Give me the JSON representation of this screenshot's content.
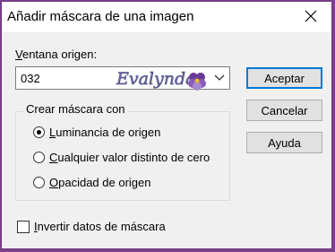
{
  "window": {
    "title": "Añadir máscara de una imagen"
  },
  "source": {
    "label_first": "V",
    "label_rest": "entana origen:",
    "value": "032",
    "watermark": "Evalynda"
  },
  "group": {
    "title": "Crear máscara con",
    "options": [
      {
        "mnemonic": "L",
        "rest": "uminancia de origen",
        "checked": true
      },
      {
        "mnemonic": "C",
        "rest": "ualquier valor distinto de cero",
        "checked": false
      },
      {
        "mnemonic": "O",
        "rest": "pacidad de origen",
        "checked": false
      }
    ]
  },
  "invert": {
    "mnemonic": "I",
    "rest": "nvertir datos de máscara",
    "checked": false
  },
  "buttons": {
    "ok": "Aceptar",
    "cancel": "Cancelar",
    "help": "Ayuda"
  },
  "icons": {
    "close": "close-icon",
    "dropdown": "chevron-down-icon",
    "watermark_flower": "flower-icon"
  },
  "colors": {
    "frame": "#7e3f8c",
    "default_button_border": "#0078d7",
    "watermark_text": "#6a6aa8"
  }
}
